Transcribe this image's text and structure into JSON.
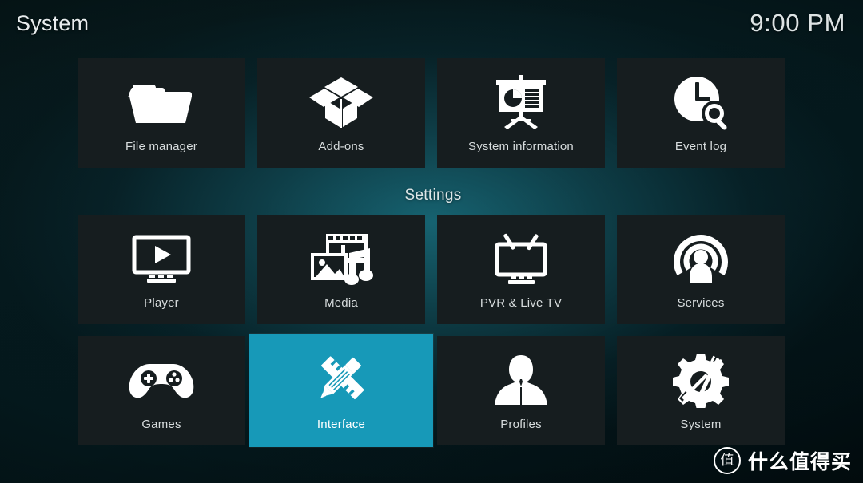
{
  "window": {
    "title": "System",
    "clock": "9:00 PM"
  },
  "colors": {
    "highlight": "#1799b8",
    "tile_background": "#161d1f",
    "background_teal": "#145461",
    "text": "#d7dcdd"
  },
  "top_row": [
    {
      "label": "File manager",
      "icon": "folder-icon",
      "selected": false
    },
    {
      "label": "Add-ons",
      "icon": "open-box-icon",
      "selected": false
    },
    {
      "label": "System information",
      "icon": "presentation-board-icon",
      "selected": false
    },
    {
      "label": "Event log",
      "icon": "clock-search-icon",
      "selected": false
    }
  ],
  "settings_section": {
    "label": "Settings",
    "rows": [
      [
        {
          "label": "Player",
          "icon": "monitor-play-icon",
          "selected": false
        },
        {
          "label": "Media",
          "icon": "film-photo-music-icon",
          "selected": false
        },
        {
          "label": "PVR & Live TV",
          "icon": "tv-antenna-icon",
          "selected": false
        },
        {
          "label": "Services",
          "icon": "broadcast-person-icon",
          "selected": false
        }
      ],
      [
        {
          "label": "Games",
          "icon": "gamepad-icon",
          "selected": false
        },
        {
          "label": "Interface",
          "icon": "pencil-ruler-icon",
          "selected": true
        },
        {
          "label": "Profiles",
          "icon": "person-icon",
          "selected": false
        },
        {
          "label": "System",
          "icon": "gear-tool-icon",
          "selected": false
        }
      ]
    ]
  },
  "watermark": {
    "badge": "值",
    "text": "什么值得买"
  }
}
